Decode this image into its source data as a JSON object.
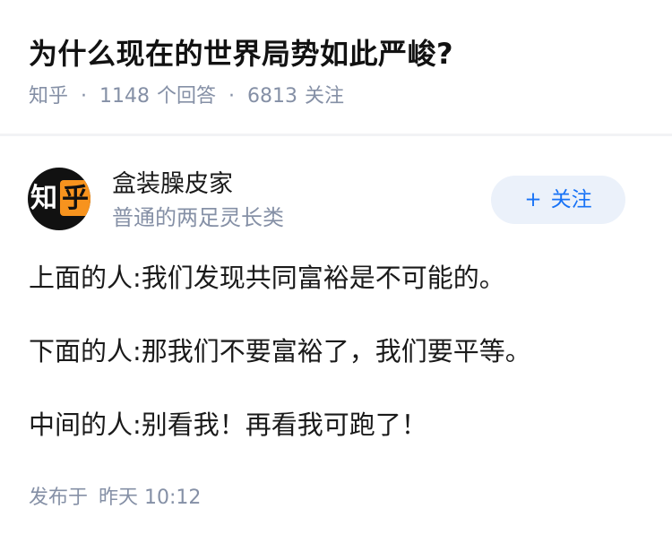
{
  "question": {
    "title": "为什么现在的世界局势如此严峻?",
    "source": "知乎",
    "separator": "·",
    "answers_count": "1148",
    "answers_label": "个回答",
    "followers_count": "6813",
    "followers_label": "关注"
  },
  "author": {
    "avatar_char_1": "知",
    "avatar_char_2": "乎",
    "name": "盒装臊皮家",
    "bio": "普通的两足灵长类",
    "follow_plus": "+",
    "follow_label": "关注"
  },
  "answer": {
    "lines": [
      "上面的人:我们发现共同富裕是不可能的。",
      "下面的人:那我们不要富裕了，我们要平等。",
      "中间的人:别看我！再看我可跑了！"
    ],
    "published_label": "发布于",
    "published_time": "昨天 10:12"
  },
  "colors": {
    "accent": "#1772f6",
    "meta_gray": "#8590a6",
    "avatar_orange": "#f7931e"
  }
}
